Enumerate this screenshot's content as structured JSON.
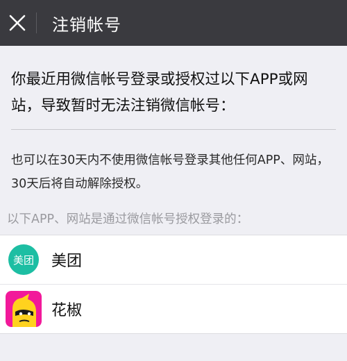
{
  "header": {
    "title": "注销帐号",
    "close_icon": "close-icon"
  },
  "main": {
    "message": "你最近用微信帐号登录或授权过以下APP或网站，导致暂时无法注销微信帐号：",
    "hint": "也可以在30天内不使用微信帐号登录其他任何APP、网站，30天后将自动解除授权。"
  },
  "apps_section": {
    "header": "以下APP、网站是通过微信帐号授权登录的：",
    "apps": [
      {
        "name": "美团",
        "icon_label": "美团",
        "icon": "meituan-icon",
        "icon_color": "#1dbea3"
      },
      {
        "name": "花椒",
        "icon": "huajiao-icon",
        "icon_color": "#f2199a"
      }
    ]
  },
  "colors": {
    "topbar": "#3a3a3f",
    "background": "#efeff4"
  }
}
